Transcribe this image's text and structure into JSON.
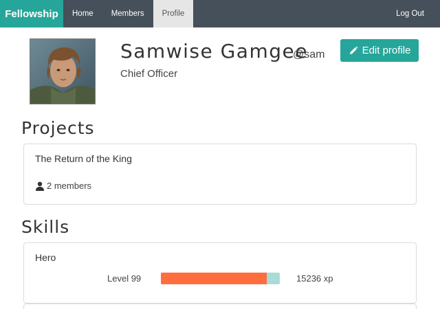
{
  "navbar": {
    "brand": "Fellowship",
    "items": [
      {
        "label": "Home",
        "active": false
      },
      {
        "label": "Members",
        "active": false
      },
      {
        "label": "Profile",
        "active": true
      }
    ],
    "logout": "Log Out"
  },
  "profile": {
    "name": "Samwise Gamgee",
    "handle": "@sam",
    "title": "Chief Officer",
    "avatar_icon": "person-photo-icon",
    "edit_button": "Edit profile",
    "edit_icon": "pencil-icon"
  },
  "projects": {
    "heading": "Projects",
    "items": [
      {
        "name": "The Return of the King",
        "members": "2 members",
        "members_icon": "user-icon"
      }
    ]
  },
  "skills": {
    "heading": "Skills",
    "items": [
      {
        "name": "Hero",
        "level": "Level 99",
        "progress_fraction": 0.89,
        "xp": "15236 xp"
      }
    ]
  },
  "colors": {
    "accent": "#26a69a",
    "navbar": "#46505a",
    "progress_fill": "#ff6d3f",
    "progress_track": "#a8dcd6"
  }
}
